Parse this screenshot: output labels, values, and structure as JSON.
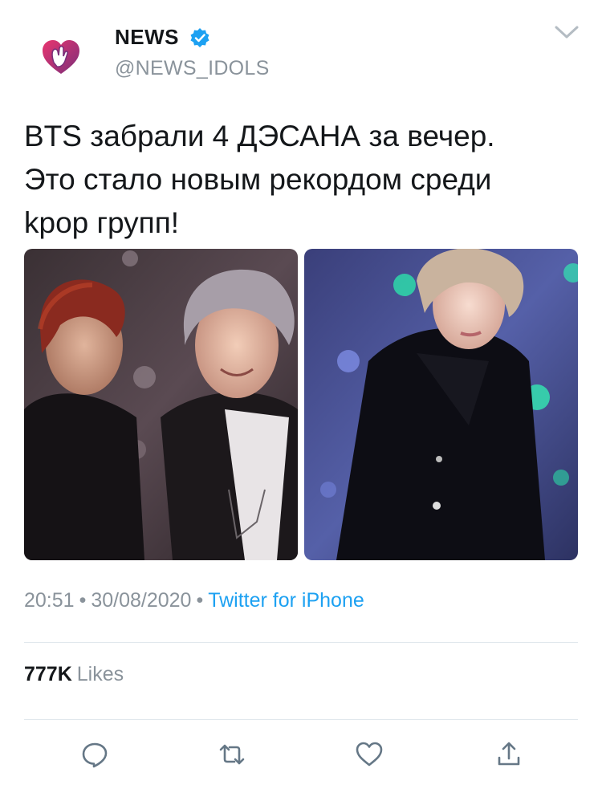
{
  "author": {
    "display_name": "NEWS",
    "handle": "@NEWS_IDOLS",
    "verified": true,
    "avatar_icon": "heart-hand-logo-icon"
  },
  "tweet": {
    "text_lines": [
      "BTS забрали 4 ДЭСАНА за вечер.",
      "Это стало новым рекордом среди",
      "kpop групп!"
    ],
    "media_count": 2
  },
  "meta": {
    "time": "20:51",
    "date": "30/08/2020",
    "source": "Twitter for iPhone",
    "separator": "•"
  },
  "stats": {
    "likes_count": "777K",
    "likes_label": "Likes"
  },
  "actions": {
    "reply_icon": "reply-icon",
    "retweet_icon": "retweet-icon",
    "like_icon": "heart-icon",
    "share_icon": "share-icon"
  },
  "colors": {
    "text": "#14171a",
    "secondary": "#8a939b",
    "link": "#1da1f2",
    "divider": "#e1e8ed",
    "brand_pink": "#e8356f",
    "brand_purple": "#7b2f7a"
  }
}
